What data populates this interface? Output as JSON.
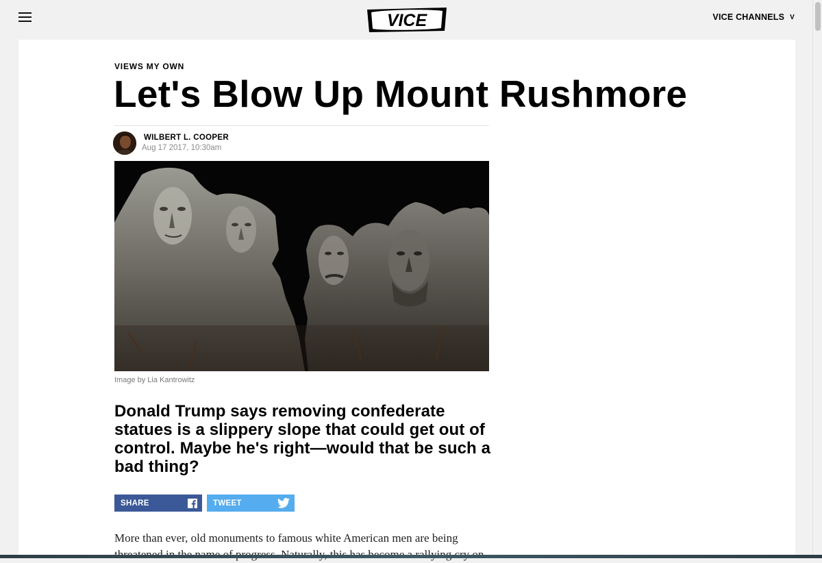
{
  "header": {
    "logo_text": "VICE",
    "channels_label": "VICE CHANNELS",
    "channels_chevron": "V"
  },
  "article": {
    "kicker": "VIEWS MY OWN",
    "title": "Let's Blow Up Mount Rushmore",
    "author": "WILBERT L. COOPER",
    "date": "Aug 17 2017, 10:30am",
    "image_caption": "Image by Lia Kantrowitz",
    "dek": "Donald Trump says removing confederate statues is a slippery slope that could get out of control. Maybe he's right—would that be such a bad thing?",
    "body_lead": "More than ever, old monuments to famous white American men are being threatened in the name of progress. Naturally, this has become a rallying cry on"
  },
  "share": {
    "facebook_label": "SHARE",
    "twitter_label": "TWEET",
    "facebook_color": "#3b5998",
    "twitter_color": "#55acee"
  },
  "icons": [
    "menu-icon",
    "vice-logo",
    "chevron-down-icon",
    "facebook-icon",
    "twitter-icon"
  ]
}
